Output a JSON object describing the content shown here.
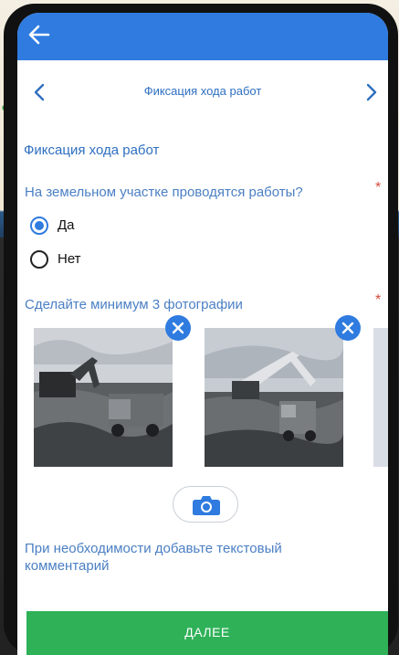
{
  "appbar": {
    "back_icon": "arrow-left-icon",
    "color": "#2f7be0"
  },
  "subheader": {
    "title": "Фиксация хода работ",
    "prev_icon": "chevron-left-icon",
    "next_icon": "chevron-right-icon"
  },
  "form": {
    "section_title": "Фиксация хода работ",
    "question": "На земельном участке проводятся работы?",
    "required_mark": "*",
    "options": [
      {
        "label": "Да",
        "selected": true
      },
      {
        "label": "Нет",
        "selected": false
      }
    ],
    "photos_label": "Сделайте минимум 3 фотографии",
    "photos_required_mark": "*",
    "photos": [
      {
        "remove_icon": "close-icon"
      },
      {
        "remove_icon": "close-icon"
      }
    ],
    "camera_icon": "camera-icon",
    "comment_prompt": "При необходимости добавьте текстовый комментарий"
  },
  "footer": {
    "next_label": "ДАЛЕЕ",
    "color": "#2fb158"
  }
}
